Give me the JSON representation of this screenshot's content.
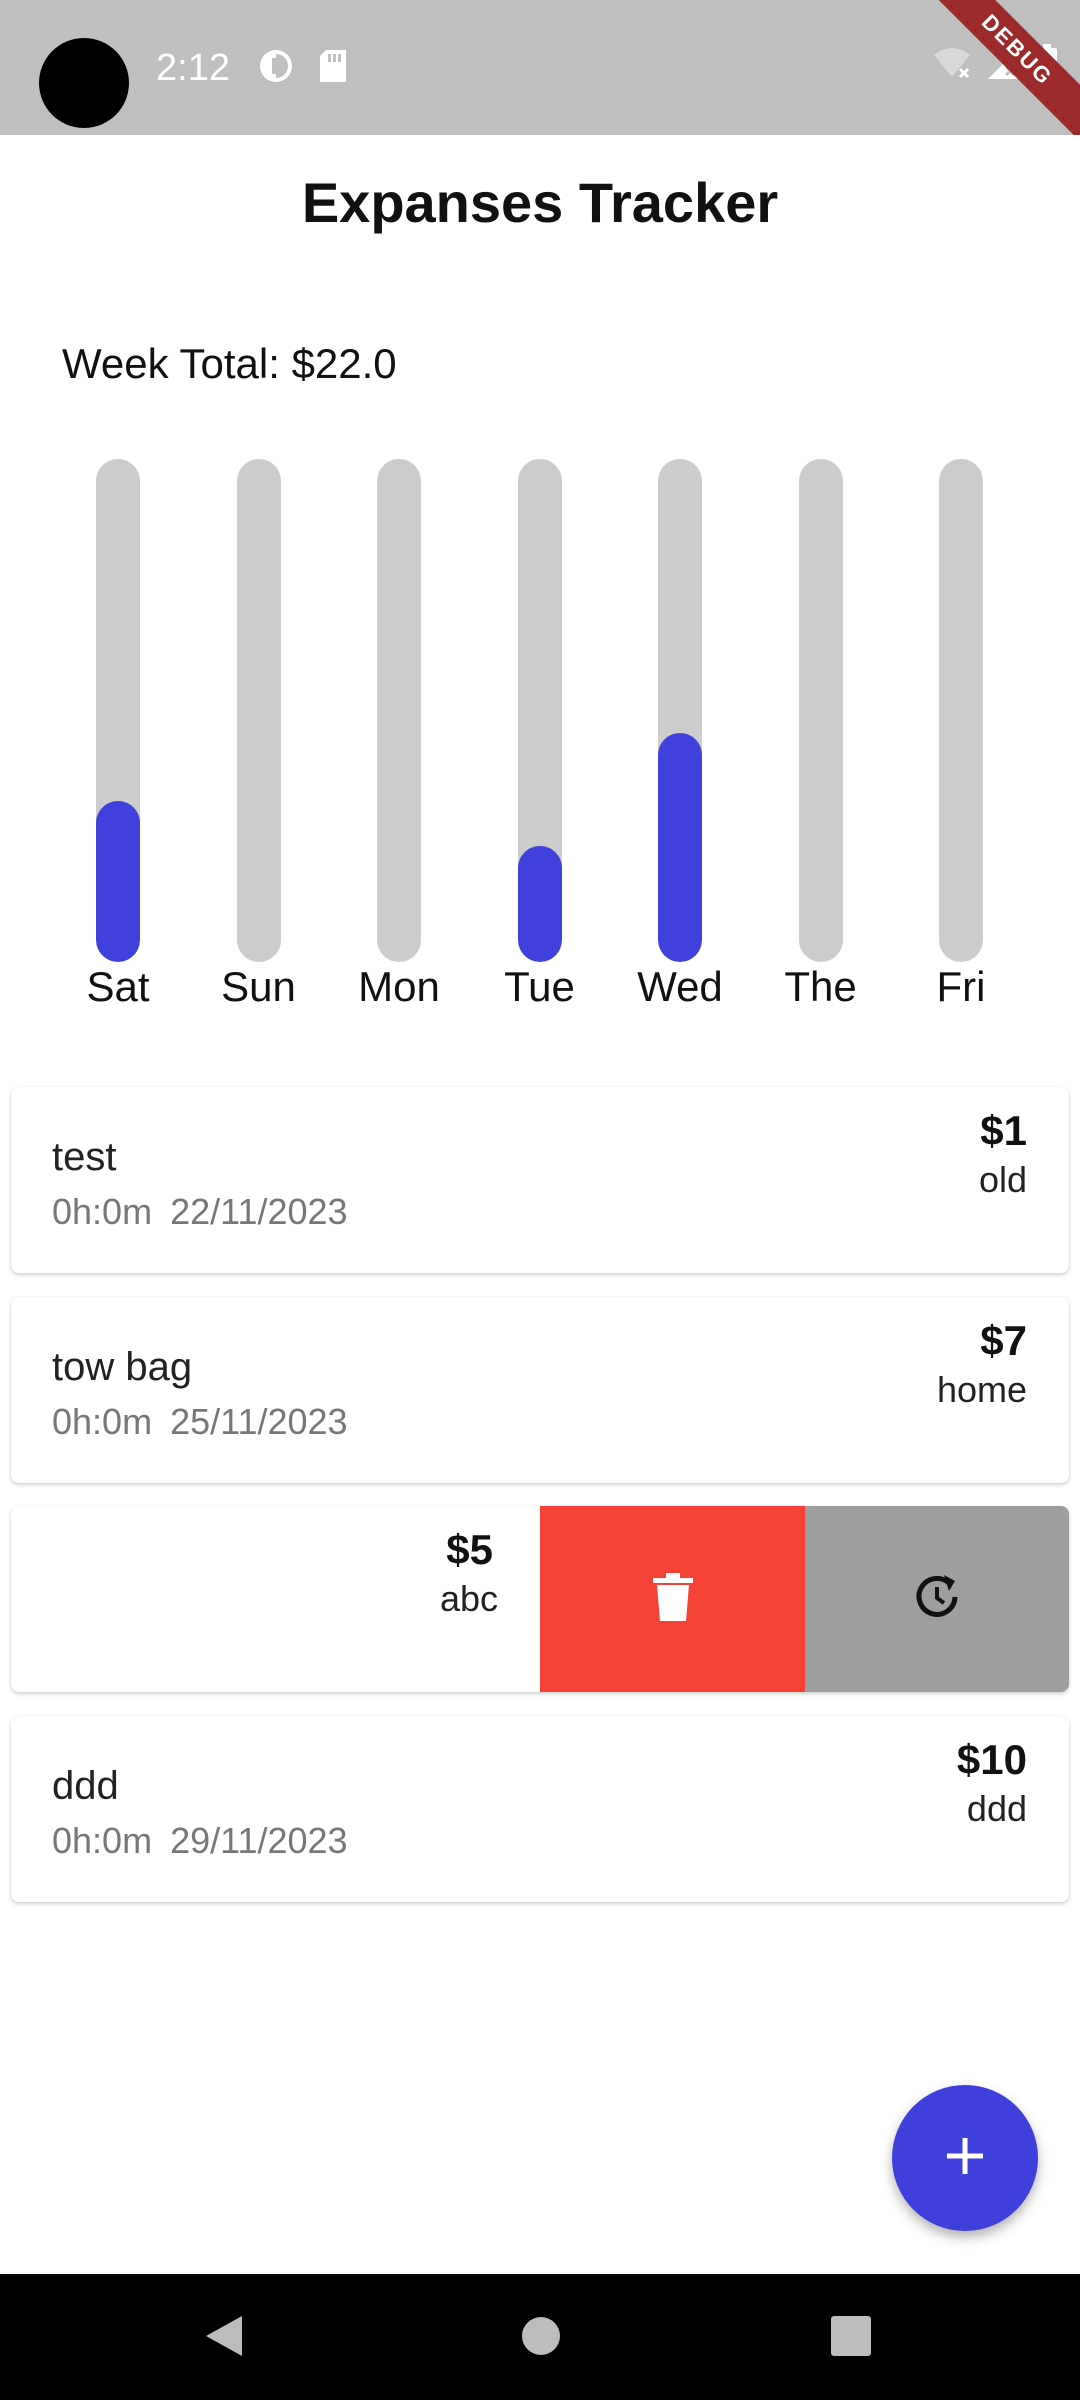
{
  "status_bar": {
    "time": "2:12",
    "debug_label": "DEBUG",
    "icons": [
      "data-saver-icon",
      "sd-card-icon",
      "wifi-off-icon",
      "signal-icon",
      "battery-icon"
    ]
  },
  "app": {
    "title": "Expanses Tracker"
  },
  "summary": {
    "week_total": "Week Total: $22.0"
  },
  "chart_data": {
    "type": "bar",
    "categories": [
      "Sat",
      "Sun",
      "Mon",
      "Tue",
      "Wed",
      "The",
      "Fri"
    ],
    "values": [
      0.32,
      0,
      0,
      0.23,
      0.455,
      0,
      0
    ],
    "ylim": [
      0,
      1
    ],
    "colors": {
      "fill": "#4040dd",
      "track": "#cccccc"
    }
  },
  "expenses": [
    {
      "title": "test",
      "time": "0h:0m",
      "date": "22/11/2023",
      "amount": "$1",
      "category": "old"
    },
    {
      "title": "tow bag",
      "time": "0h:0m",
      "date": "25/11/2023",
      "amount": "$7",
      "category": "home"
    },
    {
      "amount": "$5",
      "category": "abc"
    },
    {
      "title": "ddd",
      "time": "0h:0m",
      "date": "29/11/2023",
      "amount": "$10",
      "category": "ddd"
    }
  ],
  "swipe_actions": {
    "delete_icon": "trash-icon",
    "restore_icon": "history-icon",
    "delete_color": "#f44336",
    "restore_color": "#9e9e9e"
  },
  "fab": {
    "icon": "plus-icon",
    "color": "#3f3fdc"
  },
  "nav": {
    "icons": [
      "back-icon",
      "home-icon",
      "recents-icon"
    ]
  }
}
